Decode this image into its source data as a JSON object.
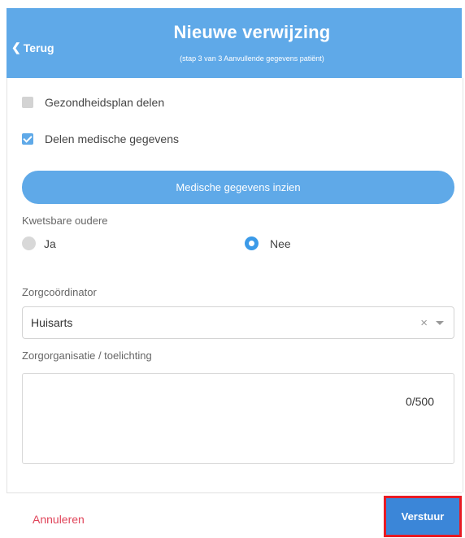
{
  "header": {
    "back_label": "Terug",
    "title": "Nieuwe verwijzing",
    "subtitle": "(stap 3 van 3 Aanvullende gegevens patiënt)"
  },
  "checkboxes": [
    {
      "label": "Gezondheidsplan delen",
      "checked": false
    },
    {
      "label": "Delen medische gegevens",
      "checked": true
    }
  ],
  "medical_button_label": "Medische gegevens inzien",
  "vulnerable_elderly": {
    "label": "Kwetsbare oudere",
    "options": [
      "Ja",
      "Nee"
    ],
    "selected": "Nee"
  },
  "care_coordinator": {
    "label": "Zorgcoördinator",
    "value": "Huisarts",
    "clear_symbol": "×"
  },
  "care_organisation": {
    "label": "Zorgorganisatie / toelichting",
    "counter": "0/500"
  },
  "footer": {
    "cancel_label": "Annuleren",
    "send_label": "Verstuur"
  },
  "colors": {
    "primary": "#5fa9e8",
    "send_button": "#3b86d8",
    "cancel_text": "#e0455a",
    "highlight_border": "#e81b24"
  }
}
